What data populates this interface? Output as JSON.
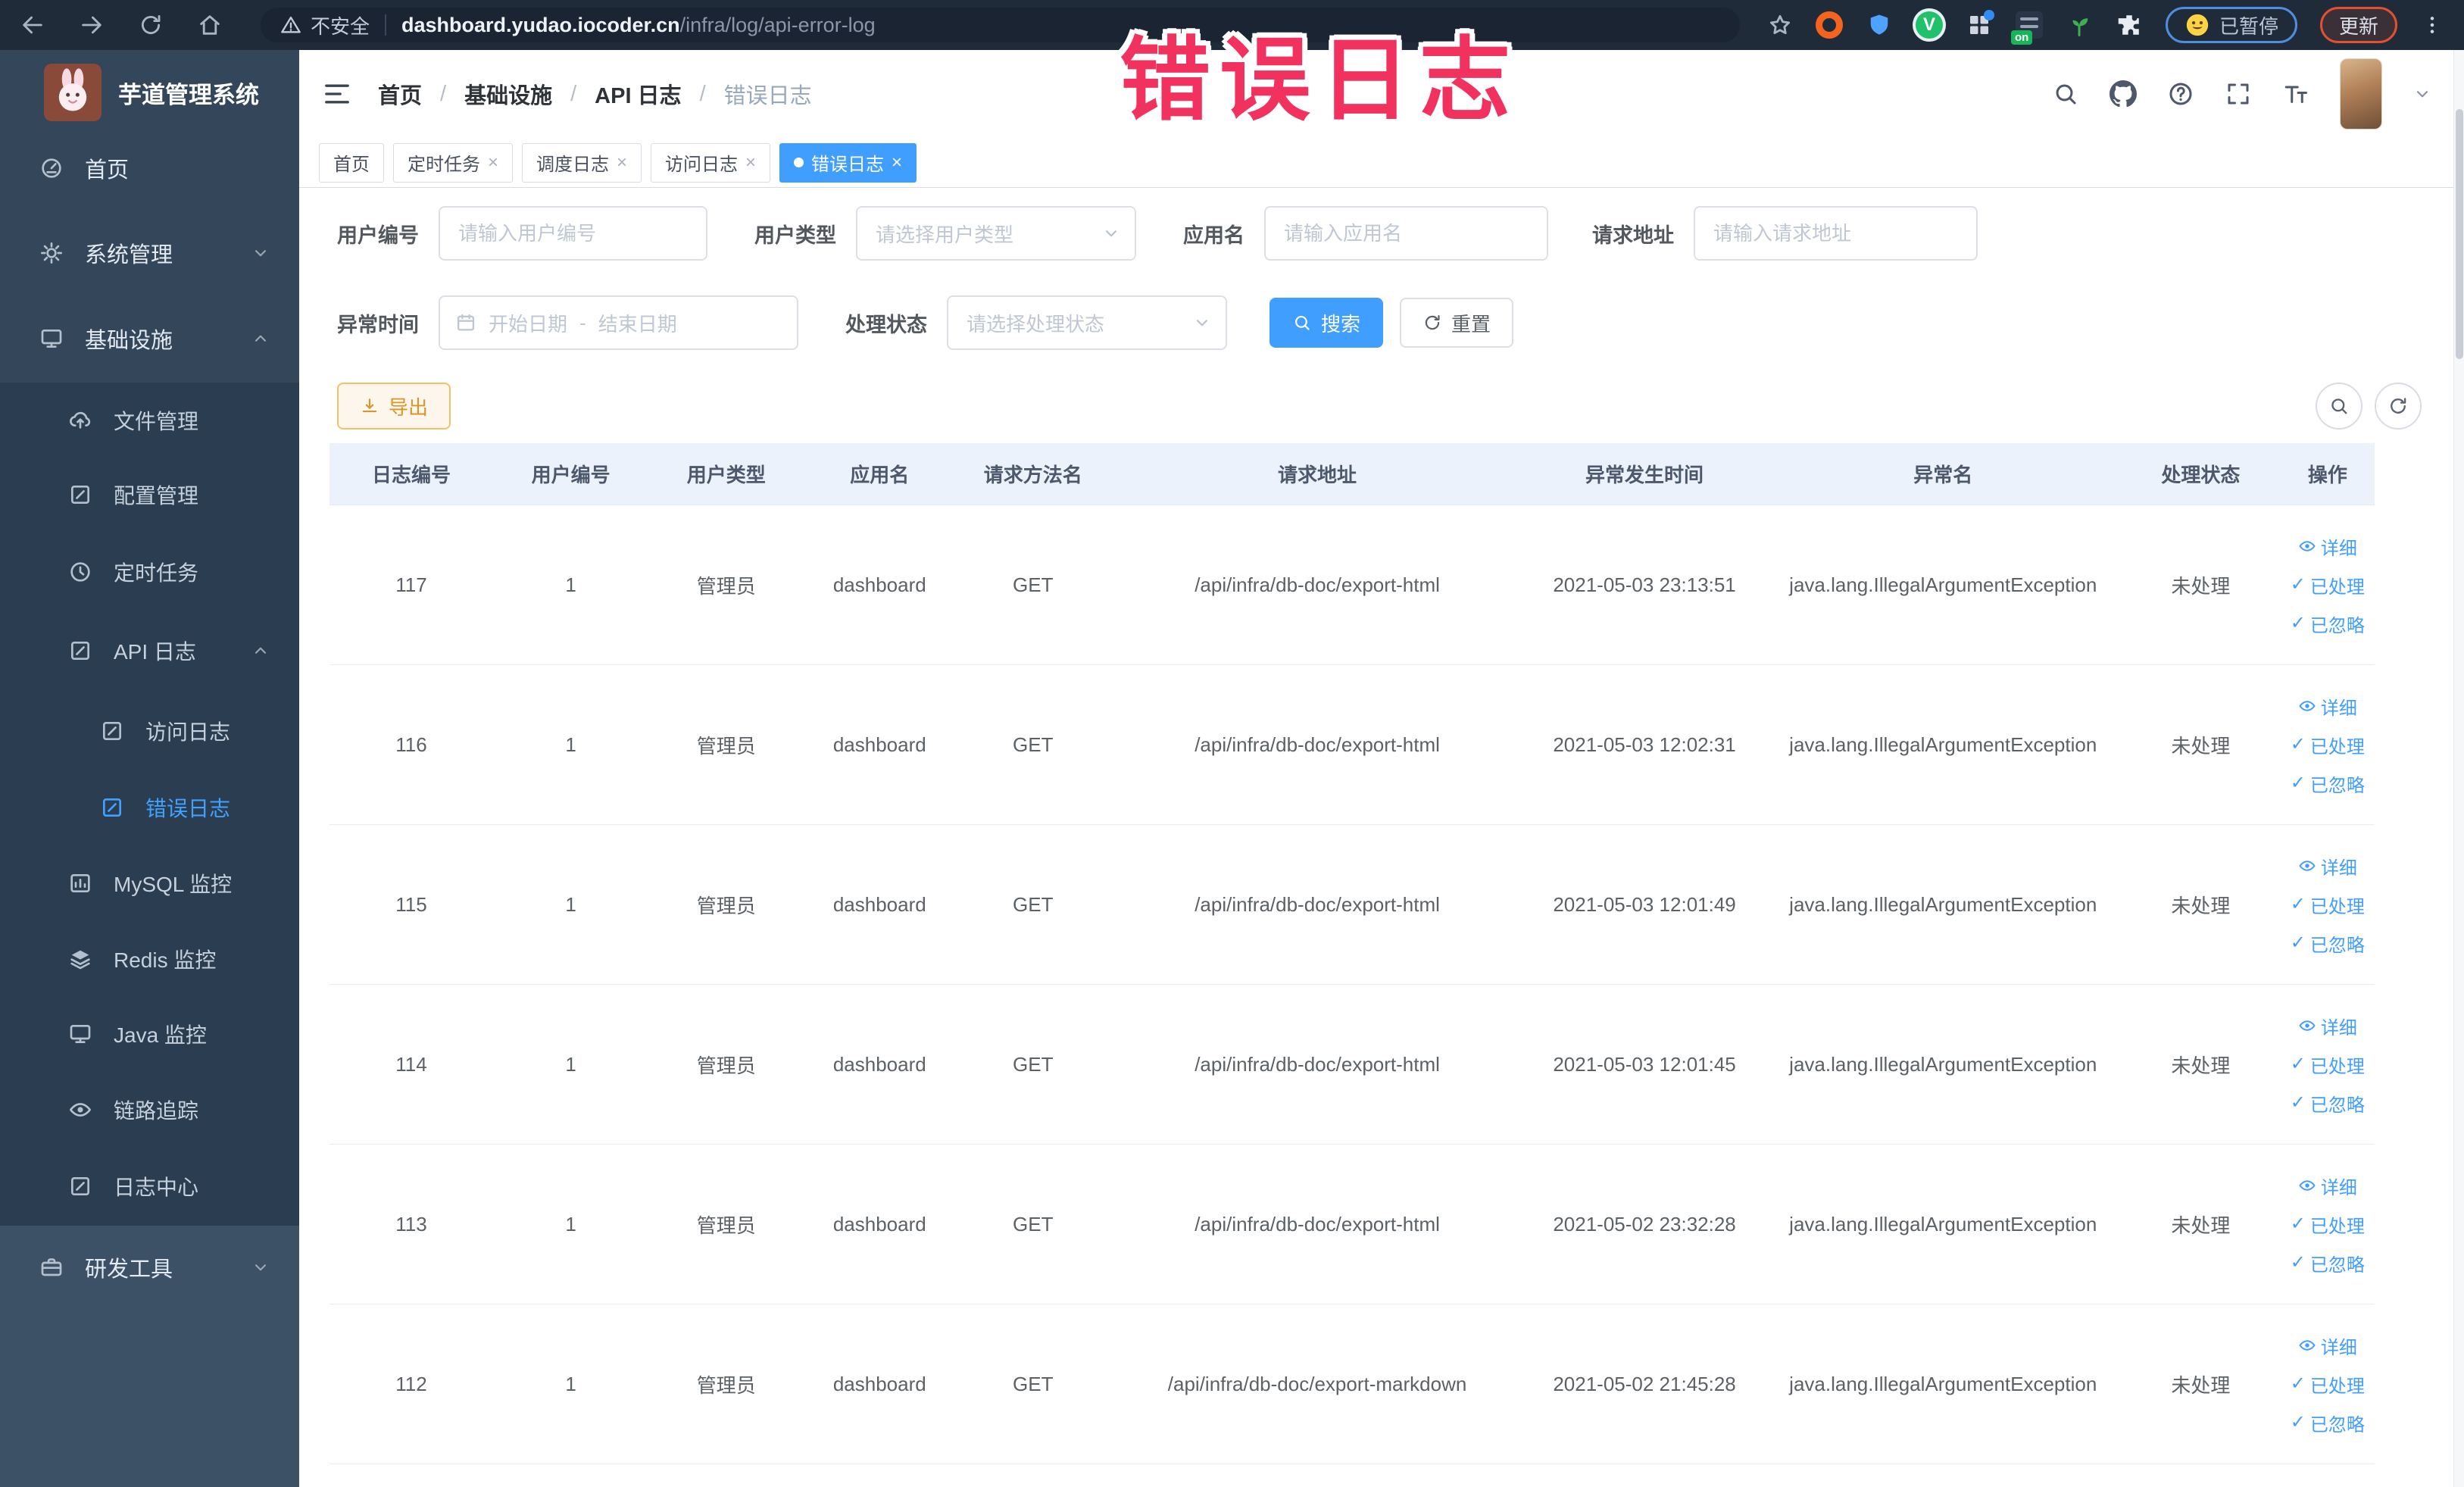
{
  "browser": {
    "security": "不安全",
    "domain": "dashboard.yudao.iocoder.cn",
    "path": "/infra/log/api-error-log",
    "paused_badge": "已暂停",
    "update_button": "更新"
  },
  "annotation": "错误日志",
  "sidebar": {
    "title": "芋道管理系统",
    "items": [
      {
        "label": "首页"
      },
      {
        "label": "系统管理"
      },
      {
        "label": "基础设施"
      },
      {
        "label": "文件管理"
      },
      {
        "label": "配置管理"
      },
      {
        "label": "定时任务"
      },
      {
        "label": "API 日志"
      },
      {
        "label": "访问日志"
      },
      {
        "label": "错误日志"
      },
      {
        "label": "MySQL 监控"
      },
      {
        "label": "Redis 监控"
      },
      {
        "label": "Java 监控"
      },
      {
        "label": "链路追踪"
      },
      {
        "label": "日志中心"
      },
      {
        "label": "研发工具"
      }
    ]
  },
  "breadcrumb": {
    "items": [
      "首页",
      "基础设施",
      "API 日志",
      "错误日志"
    ],
    "separator": "/"
  },
  "tabs": [
    {
      "label": "首页"
    },
    {
      "label": "定时任务"
    },
    {
      "label": "调度日志"
    },
    {
      "label": "访问日志"
    },
    {
      "label": "错误日志"
    }
  ],
  "filters": {
    "user_id": {
      "label": "用户编号",
      "placeholder": "请输入用户编号"
    },
    "user_type": {
      "label": "用户类型",
      "placeholder": "请选择用户类型"
    },
    "app_name": {
      "label": "应用名",
      "placeholder": "请输入应用名"
    },
    "request_url": {
      "label": "请求地址",
      "placeholder": "请输入请求地址"
    },
    "exception_time": {
      "label": "异常时间",
      "start": "开始日期",
      "separator": "-",
      "end": "结束日期"
    },
    "process_status": {
      "label": "处理状态",
      "placeholder": "请选择处理状态"
    },
    "search": "搜索",
    "reset": "重置"
  },
  "toolbar": {
    "export_button": "导出"
  },
  "table": {
    "columns": [
      "日志编号",
      "用户编号",
      "用户类型",
      "应用名",
      "请求方法名",
      "请求地址",
      "异常发生时间",
      "异常名",
      "处理状态",
      "操作"
    ],
    "rows": [
      {
        "log_id": "117",
        "user_id": "1",
        "user_type": "管理员",
        "app_name": "dashboard",
        "method": "GET",
        "url": "/api/infra/db-doc/export-html",
        "time": "2021-05-03 23:13:51",
        "exception": "java.lang.IllegalArgumentException",
        "status": "未处理"
      },
      {
        "log_id": "116",
        "user_id": "1",
        "user_type": "管理员",
        "app_name": "dashboard",
        "method": "GET",
        "url": "/api/infra/db-doc/export-html",
        "time": "2021-05-03 12:02:31",
        "exception": "java.lang.IllegalArgumentException",
        "status": "未处理"
      },
      {
        "log_id": "115",
        "user_id": "1",
        "user_type": "管理员",
        "app_name": "dashboard",
        "method": "GET",
        "url": "/api/infra/db-doc/export-html",
        "time": "2021-05-03 12:01:49",
        "exception": "java.lang.IllegalArgumentException",
        "status": "未处理"
      },
      {
        "log_id": "114",
        "user_id": "1",
        "user_type": "管理员",
        "app_name": "dashboard",
        "method": "GET",
        "url": "/api/infra/db-doc/export-html",
        "time": "2021-05-03 12:01:45",
        "exception": "java.lang.IllegalArgumentException",
        "status": "未处理"
      },
      {
        "log_id": "113",
        "user_id": "1",
        "user_type": "管理员",
        "app_name": "dashboard",
        "method": "GET",
        "url": "/api/infra/db-doc/export-html",
        "time": "2021-05-02 23:32:28",
        "exception": "java.lang.IllegalArgumentException",
        "status": "未处理"
      },
      {
        "log_id": "112",
        "user_id": "1",
        "user_type": "管理员",
        "app_name": "dashboard",
        "method": "GET",
        "url": "/api/infra/db-doc/export-markdown",
        "time": "2021-05-02 21:45:28",
        "exception": "java.lang.IllegalArgumentException",
        "status": "未处理"
      }
    ],
    "actions": {
      "detail": "详细",
      "processed": "已处理",
      "ignored": "已忽略"
    }
  },
  "icons": {
    "check": "✓",
    "close": "×"
  },
  "colors": {
    "accent": "#409eff",
    "annotation_pink": "#f1315e",
    "sidebar_bg": "#33465a",
    "submenu_bg": "#2b3d50",
    "warning": "#e6a23c",
    "toolbar_bg": "#202b3a",
    "table_header_bg": "#ecf2fb"
  }
}
